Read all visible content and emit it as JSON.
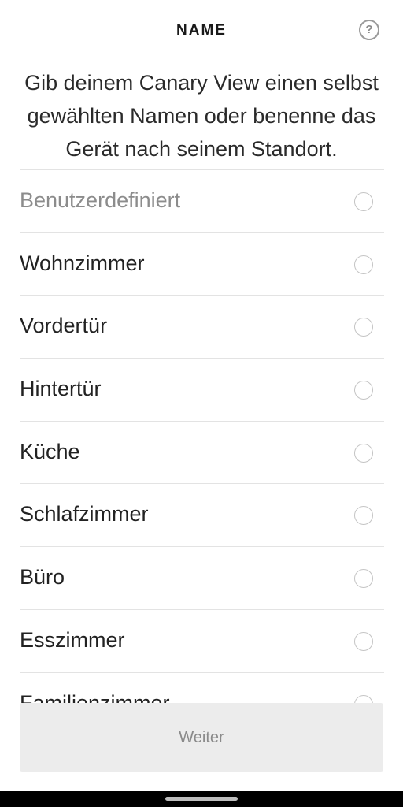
{
  "header": {
    "title": "NAME",
    "help_label": "?"
  },
  "description": "Gib deinem Canary View einen selbst gewählten Namen oder benenne das Gerät nach seinem Standort.",
  "options": [
    {
      "label": "Benutzerdefiniert",
      "muted": true
    },
    {
      "label": "Wohnzimmer"
    },
    {
      "label": "Vordertür"
    },
    {
      "label": "Hintertür"
    },
    {
      "label": "Küche"
    },
    {
      "label": "Schlafzimmer"
    },
    {
      "label": "Büro"
    },
    {
      "label": "Esszimmer"
    },
    {
      "label": "Familienzimmer"
    }
  ],
  "footer": {
    "continue_label": "Weiter"
  }
}
